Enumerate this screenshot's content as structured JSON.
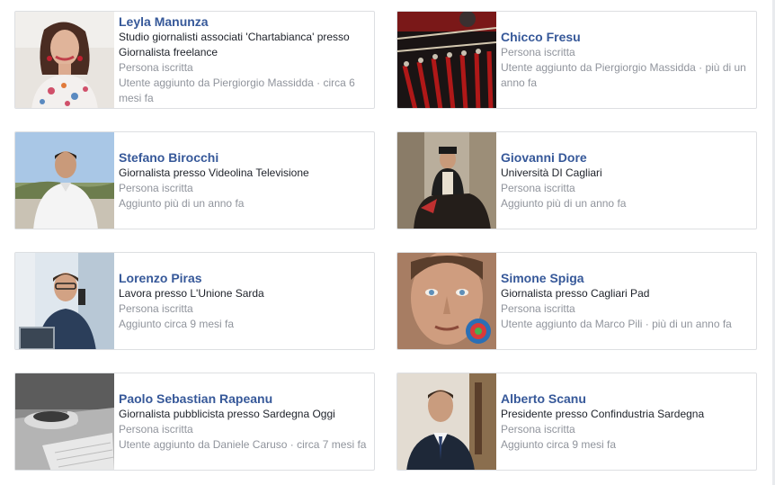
{
  "people": [
    {
      "name": "Leyla Manunza",
      "lines": [
        "Studio giornalisti associati 'Chartabianca' presso Giornalista freelance"
      ],
      "type": "Persona iscritta",
      "added": "Utente aggiunto da Piergiorgio Massidda · circa 6 mesi fa",
      "photo": "woman-portrait"
    },
    {
      "name": "Chicco Fresu",
      "lines": [],
      "type": "Persona iscritta",
      "added": "Utente aggiunto da Piergiorgio Massidda · più di un anno fa",
      "photo": "guitars-photo"
    },
    {
      "name": "Stefano Birocchi",
      "lines": [
        "Giornalista presso Videolina Televisione"
      ],
      "type": "Persona iscritta",
      "added": "Aggiunto più di un anno fa",
      "photo": "man-outdoor-portrait"
    },
    {
      "name": "Giovanni Dore",
      "lines": [
        "Università DI Cagliari"
      ],
      "type": "Persona iscritta",
      "added": "Aggiunto più di un anno fa",
      "photo": "horse-rider-photo"
    },
    {
      "name": "Lorenzo Piras",
      "lines": [
        "Lavora presso L'Unione Sarda"
      ],
      "type": "Persona iscritta",
      "added": "Aggiunto circa 9 mesi fa",
      "photo": "man-desk-portrait"
    },
    {
      "name": "Simone Spiga",
      "lines": [
        "Giornalista presso Cagliari Pad"
      ],
      "type": "Persona iscritta",
      "added": "Utente aggiunto da Marco Pili · più di un anno fa",
      "photo": "man-closeup-portrait"
    },
    {
      "name": "Paolo Sebastian Rapeanu",
      "lines": [
        "Giornalista pubblicista presso Sardegna Oggi"
      ],
      "type": "Persona iscritta",
      "added": "Utente aggiunto da Daniele Caruso · circa 7 mesi fa",
      "photo": "coffee-notebook-photo"
    },
    {
      "name": "Alberto Scanu",
      "lines": [
        "Presidente presso Confindustria Sardegna"
      ],
      "type": "Persona iscritta",
      "added": "Aggiunto circa 9 mesi fa",
      "photo": "man-suit-portrait"
    }
  ]
}
